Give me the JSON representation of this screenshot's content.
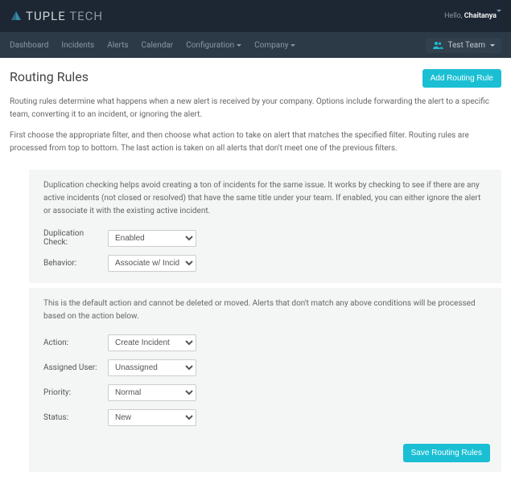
{
  "brand": {
    "part1": "TUPLE",
    "part2": "TECH"
  },
  "greeting": {
    "hello": "Hello,",
    "name": "Chaitanya"
  },
  "nav": {
    "items": [
      "Dashboard",
      "Incidents",
      "Alerts",
      "Calendar",
      "Configuration",
      "Company"
    ],
    "team": "Test Team"
  },
  "page": {
    "title": "Routing Rules",
    "addBtn": "Add Routing Rule",
    "intro1": "Routing rules determine what happens when a new alert is received by your company. Options include forwarding the alert to a specific team, converting it to an incident, or ignoring the alert.",
    "intro2": "First choose the appropriate filter, and then choose what action to take on alert that matches the specified filter. Routing rules are processed from top to bottom. The last action is taken on all alerts that don't meet one of the previous filters."
  },
  "dup": {
    "text": "Duplication checking helps avoid creating a ton of incidents for the same issue. It works by checking to see if there are any active incidents (not closed or resolved) that have the same title under your team. If enabled, you can either ignore the alert or associate it with the existing active incident.",
    "checkLabel": "Duplication Check:",
    "checkValue": "Enabled",
    "behaviorLabel": "Behavior:",
    "behaviorValue": "Associate w/ Incident"
  },
  "def": {
    "text": "This is the default action and cannot be deleted or moved. Alerts that don't match any above conditions will be processed based on the action below.",
    "actionLabel": "Action:",
    "actionValue": "Create Incident",
    "userLabel": "Assigned User:",
    "userValue": "Unassigned",
    "priorityLabel": "Priority:",
    "priorityValue": "Normal",
    "statusLabel": "Status:",
    "statusValue": "New",
    "saveBtn": "Save Routing Rules"
  }
}
